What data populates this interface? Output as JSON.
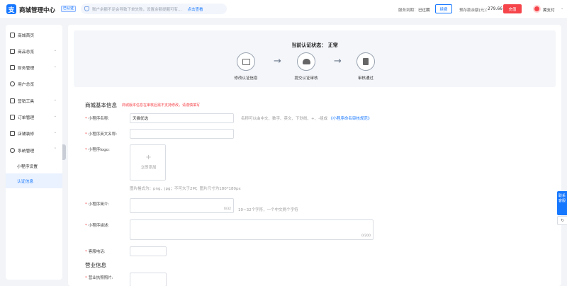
{
  "header": {
    "logo_glyph": "支",
    "app_title": "商城管理中心",
    "badge": "已认证",
    "notice_text": "账户余额不足会导致下单失败，设置余额提醒可有…",
    "notice_link": "点击查看",
    "service_label": "服务到期：",
    "service_value": "已过期",
    "renew_label": "续费",
    "balance_label": "预存款余额(元)：",
    "balance_value": "279.66",
    "recharge_label": "充值",
    "user_name": "翼支付",
    "user_caret": "⌄"
  },
  "sidebar": {
    "items": [
      {
        "label": "商城首页",
        "caret": ""
      },
      {
        "label": "商品总览",
        "caret": "⌄"
      },
      {
        "label": "财务管理",
        "caret": "⌄"
      },
      {
        "label": "用户总览",
        "caret": ""
      },
      {
        "label": "营销工具",
        "caret": "⌄"
      },
      {
        "label": "订单管理",
        "caret": "⌄"
      },
      {
        "label": "店铺装修",
        "caret": "⌄"
      },
      {
        "label": "系统管理",
        "caret": "⌃"
      }
    ],
    "sub_items": [
      {
        "label": "小程序设置",
        "active": false
      },
      {
        "label": "认证信息",
        "active": true
      }
    ]
  },
  "status": {
    "title": "当前认证状态：  正常",
    "steps": [
      {
        "label": "修改认证信息",
        "icon": "id-card-icon"
      },
      {
        "label": "提交认证审核",
        "icon": "cloud-upload-icon"
      },
      {
        "label": "审核通过",
        "icon": "clipboard-check-icon"
      }
    ],
    "arrow": "→"
  },
  "form": {
    "section1_title": "商城基本信息",
    "section1_note": "商城版本信息在审核后需不支持修改，请谨慎填写",
    "name_label": "小程序名称:",
    "name_value": "天猫优选",
    "name_hint": "名称可以由中文、数字、英文、下划线、+、-组成",
    "name_hint_link": "《小程序命名审核规范》",
    "en_name_label": "小程序英文名称:",
    "logo_label": "小程序logo:",
    "logo_plus": "+",
    "logo_upload": "立即添加",
    "logo_hint": "图片格式为：png、jpg；不可大于2M；图片尺寸为180*180px",
    "intro_label": "小程序简介:",
    "intro_counter": "0/32",
    "intro_hint": "10~32个字符，一个中文两个字符",
    "desc_label": "小程序描述:",
    "desc_counter": "0/200",
    "phone_label": "客服电话:",
    "section2_title": "营业信息",
    "license_label": "营业执照照片:"
  },
  "float": {
    "service_label": "联系客服",
    "refresh_glyph": "↻"
  }
}
